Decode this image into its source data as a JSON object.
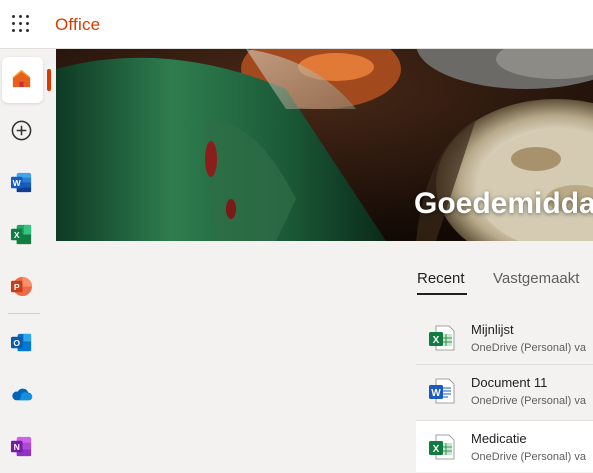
{
  "app": {
    "brand": "Office",
    "brand_color": "#d83b01"
  },
  "topbar": {
    "waffle_icon": "app-launcher-icon"
  },
  "rail": {
    "items": [
      {
        "id": "home",
        "icon": "home-icon",
        "active": true
      },
      {
        "id": "create",
        "icon": "add-circle-icon"
      },
      {
        "id": "word",
        "icon": "word-icon",
        "color": "#185abd"
      },
      {
        "id": "excel",
        "icon": "excel-icon",
        "color": "#107c41"
      },
      {
        "id": "powerpoint",
        "icon": "powerpoint-icon",
        "color": "#c43e1c"
      },
      {
        "id": "outlook",
        "icon": "outlook-icon",
        "color": "#0f6cbd"
      },
      {
        "id": "onedrive",
        "icon": "onedrive-icon",
        "color": "#0364b8"
      },
      {
        "id": "onenote",
        "icon": "onenote-icon",
        "color": "#7719aa"
      }
    ]
  },
  "hero": {
    "greeting": "Goedemiddag"
  },
  "tabs": [
    {
      "label": "Recent",
      "active": true
    },
    {
      "label": "Vastgemaakt",
      "active": false
    }
  ],
  "files": [
    {
      "name": "Mijnlijst",
      "location": "OneDrive (Personal) va",
      "type": "excel",
      "icon": "excel-file-icon"
    },
    {
      "name": "Document 11",
      "location": "OneDrive (Personal) va",
      "type": "word",
      "icon": "word-file-icon"
    },
    {
      "name": "Medicatie",
      "location": "OneDrive (Personal) va",
      "type": "excel",
      "icon": "excel-file-icon"
    }
  ]
}
